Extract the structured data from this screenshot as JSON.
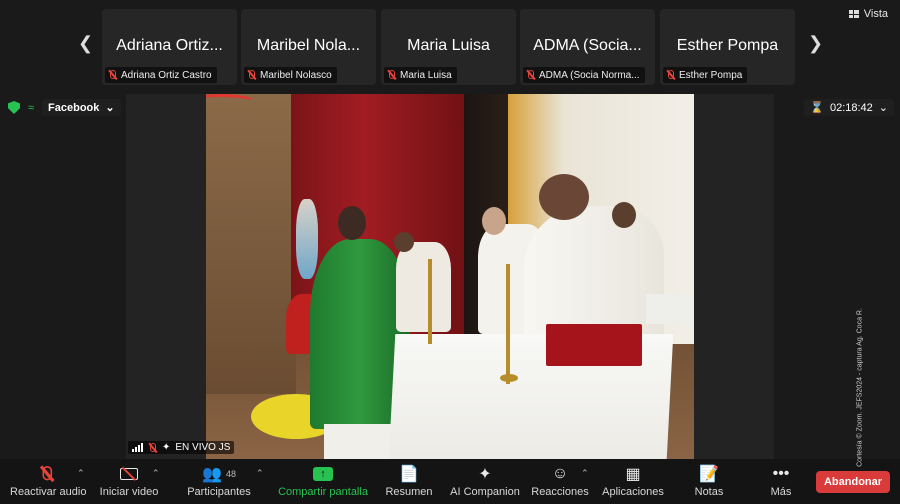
{
  "view_button": {
    "label": "Vista"
  },
  "participants_strip": [
    {
      "display_name": "Adriana Ortiz...",
      "label": "Adriana Ortiz Castro"
    },
    {
      "display_name": "Maribel Nola...",
      "label": "Maribel Nolasco"
    },
    {
      "display_name": "Maria Luisa",
      "label": "Maria Luisa"
    },
    {
      "display_name": "ADMA (Socia...",
      "label": "ADMA (Socia Norma..."
    },
    {
      "display_name": "Esther Pompa",
      "label": "Esther Pompa"
    }
  ],
  "livestream": {
    "platform": "Facebook"
  },
  "timer": {
    "value": "02:18:42"
  },
  "video_status": {
    "label": "EN VIVO JS"
  },
  "toolbar": {
    "audio": "Reactivar audio",
    "video": "Iniciar video",
    "participants": "Participantes",
    "participant_count": "48",
    "share": "Compartir pantalla",
    "summary": "Resumen",
    "ai": "AI Companion",
    "reactions": "Reacciones",
    "apps": "Aplicaciones",
    "notes": "Notas",
    "more": "Más",
    "leave": "Abandonar"
  },
  "credit": "Cortesía © Zoom. JEFS2024 - captura Ag. Coca R.",
  "colors": {
    "accent_green": "#27c251",
    "leave_red": "#d93b3b",
    "mute_red": "#e8443a"
  }
}
